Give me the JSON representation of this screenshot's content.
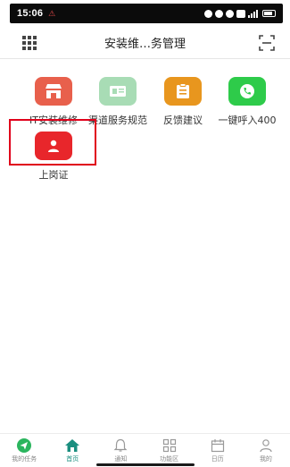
{
  "status_bar": {
    "time": "15:06",
    "alert": "⚠"
  },
  "header": {
    "title": "安装维…务管理"
  },
  "apps": [
    {
      "label": "IT安装维修",
      "icon": "storefront-icon",
      "color": "#e8604c"
    },
    {
      "label": "渠道服务规范",
      "icon": "id-card-icon",
      "color": "#a8dcb5"
    },
    {
      "label": "反馈建议",
      "icon": "clipboard-icon",
      "color": "#e8961e"
    },
    {
      "label": "一键呼入400",
      "icon": "phone-icon",
      "color": "#2ecb4a"
    },
    {
      "label": "上岗证",
      "icon": "user-icon",
      "color": "#e8262b"
    }
  ],
  "tabs": [
    {
      "label": "我的任务",
      "icon": "send-icon",
      "active": false
    },
    {
      "label": "首页",
      "icon": "home-icon",
      "active": true
    },
    {
      "label": "通知",
      "icon": "bell-icon",
      "active": false
    },
    {
      "label": "功能区",
      "icon": "grid-icon",
      "active": false
    },
    {
      "label": "日历",
      "icon": "calendar-icon",
      "active": false
    },
    {
      "label": "我的",
      "icon": "person-icon",
      "active": false
    }
  ],
  "colors": {
    "accent": "#1a8e7f",
    "highlight": "#e0001b"
  }
}
